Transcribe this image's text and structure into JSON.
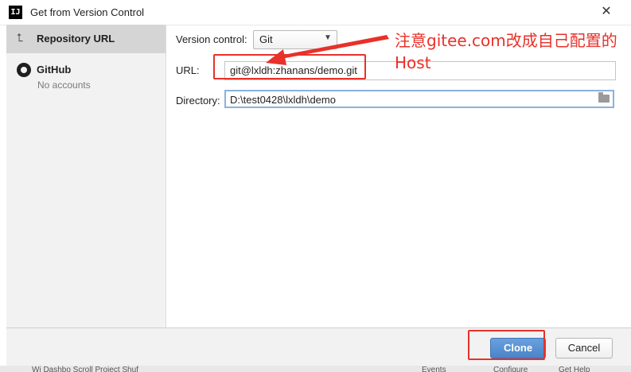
{
  "window": {
    "title": "Get from Version Control",
    "app_icon_text": "IJ",
    "close_glyph": "✕"
  },
  "sidebar": {
    "items": [
      {
        "label": "Repository URL",
        "icon": "repository-url-icon"
      },
      {
        "label": "GitHub",
        "sublabel": "No accounts",
        "icon": "github-icon"
      }
    ]
  },
  "form": {
    "version_control_label": "Version control:",
    "version_control_value": "Git",
    "url_label": "URL:",
    "url_value": "git@lxldh:zhanans/demo.git",
    "directory_label": "Directory:",
    "directory_value": "D:\\test0428\\lxldh\\demo"
  },
  "buttons": {
    "clone": "Clone",
    "cancel": "Cancel"
  },
  "annotation": {
    "note": "注意gitee.com改成自己配置的Host",
    "color": "#e8312a"
  },
  "background_window": {
    "texts": [
      "Wi Dashbo Scroll Project Shuf",
      "Events",
      "Configure",
      "Get Help"
    ]
  },
  "colors": {
    "accent": "#4a84c8",
    "sidebar_bg": "#f2f2f2",
    "selected_bg": "#d5d5d5"
  }
}
